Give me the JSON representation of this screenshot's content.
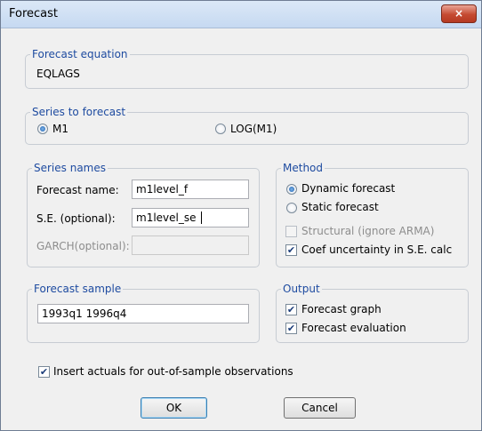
{
  "window": {
    "title": "Forecast",
    "close_label": "×"
  },
  "equation": {
    "legend": "Forecast equation",
    "value": "EQLAGS"
  },
  "series_to_forecast": {
    "legend": "Series to forecast",
    "options": [
      {
        "label": "M1",
        "selected": true
      },
      {
        "label": "LOG(M1)",
        "selected": false
      }
    ]
  },
  "series_names": {
    "legend": "Series names",
    "forecast_name_label": "Forecast name:",
    "forecast_name_value": "m1level_f",
    "se_label": "S.E. (optional):",
    "se_value": "m1level_se",
    "garch_label": "GARCH(optional):",
    "garch_value": ""
  },
  "method": {
    "legend": "Method",
    "dynamic_label": "Dynamic forecast",
    "static_label": "Static forecast",
    "selected": "dynamic",
    "structural_label": "Structural (ignore ARMA)",
    "structural_checked": false,
    "coef_label": "Coef uncertainty in S.E. calc",
    "coef_checked": true
  },
  "sample": {
    "legend": "Forecast sample",
    "value": "1993q1 1996q4"
  },
  "output": {
    "legend": "Output",
    "graph_label": "Forecast graph",
    "graph_checked": true,
    "evaluation_label": "Forecast evaluation",
    "evaluation_checked": true
  },
  "insert_actuals": {
    "label": "Insert actuals for out-of-sample observations",
    "checked": true
  },
  "buttons": {
    "ok": "OK",
    "cancel": "Cancel"
  }
}
